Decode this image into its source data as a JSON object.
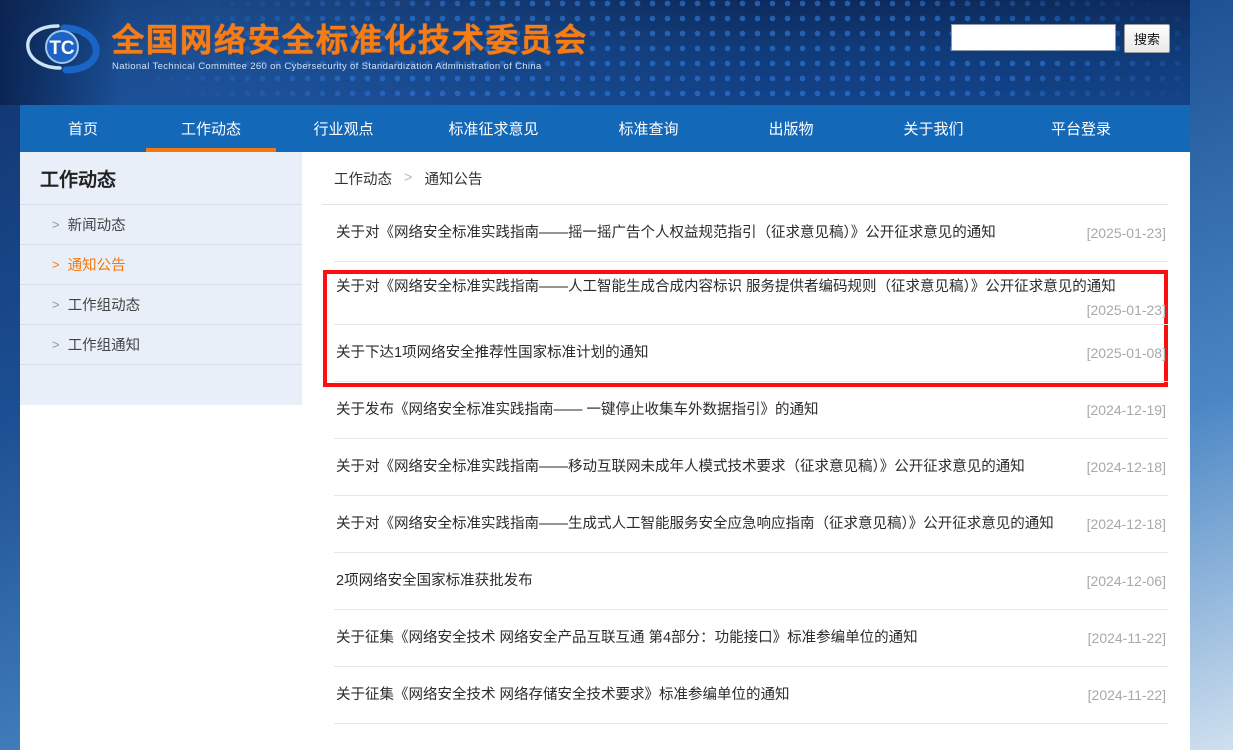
{
  "site": {
    "logo_icon": "tc-emblem-icon",
    "title_cn": "全国网络安全标准化技术委员会",
    "title_en": "National Technical Committee 260 on Cybersecurity of Standardization Administration of China"
  },
  "search": {
    "value": "",
    "placeholder": "",
    "button_label": "搜索"
  },
  "nav": {
    "items": [
      {
        "label": "首页",
        "active": false
      },
      {
        "label": "工作动态",
        "active": true
      },
      {
        "label": "行业观点",
        "active": false
      },
      {
        "label": "标准征求意见",
        "active": false
      },
      {
        "label": "标准查询",
        "active": false
      },
      {
        "label": "出版物",
        "active": false
      },
      {
        "label": "关于我们",
        "active": false
      },
      {
        "label": "平台登录",
        "active": false
      }
    ]
  },
  "sidebar": {
    "title": "工作动态",
    "chevron": ">",
    "items": [
      {
        "label": "新闻动态",
        "active": false
      },
      {
        "label": "通知公告",
        "active": true
      },
      {
        "label": "工作组动态",
        "active": false
      },
      {
        "label": "工作组通知",
        "active": false
      }
    ]
  },
  "breadcrumb": {
    "parent": "工作动态",
    "separator": ">",
    "current": "通知公告"
  },
  "news": {
    "items": [
      {
        "title": "关于对《网络安全标准实践指南——摇一摇广告个人权益规范指引（征求意见稿）》公开征求意见的通知",
        "date": "[2025-01-23]",
        "highlighted": true,
        "wrapped": false
      },
      {
        "title": "关于对《网络安全标准实践指南——人工智能生成合成内容标识 服务提供者编码规则（征求意见稿）》公开征求意见的通知",
        "date": "[2025-01-23]",
        "highlighted": true,
        "wrapped": true
      },
      {
        "title": "关于下达1项网络安全推荐性国家标准计划的通知",
        "date": "[2025-01-08]",
        "highlighted": false,
        "wrapped": false
      },
      {
        "title": "关于发布《网络安全标准实践指南—— 一键停止收集车外数据指引》的通知",
        "date": "[2024-12-19]",
        "highlighted": false,
        "wrapped": false
      },
      {
        "title": "关于对《网络安全标准实践指南——移动互联网未成年人模式技术要求（征求意见稿）》公开征求意见的通知",
        "date": "[2024-12-18]",
        "highlighted": false,
        "wrapped": false
      },
      {
        "title": "关于对《网络安全标准实践指南——生成式人工智能服务安全应急响应指南（征求意见稿）》公开征求意见的通知",
        "date": "[2024-12-18]",
        "highlighted": false,
        "wrapped": false
      },
      {
        "title": "2项网络安全国家标准获批发布",
        "date": "[2024-12-06]",
        "highlighted": false,
        "wrapped": false
      },
      {
        "title": "关于征集《网络安全技术 网络安全产品互联互通 第4部分：功能接口》标准参编单位的通知",
        "date": "[2024-11-22]",
        "highlighted": false,
        "wrapped": false
      },
      {
        "title": "关于征集《网络安全技术 网络存储安全技术要求》标准参编单位的通知",
        "date": "[2024-11-22]",
        "highlighted": false,
        "wrapped": false
      }
    ]
  },
  "colors": {
    "brand_orange": "#f4780f",
    "nav_blue": "#1468b8",
    "header_dark_blue": "#103a77",
    "highlight_red": "#fb0f0f",
    "sidebar_bg": "#e9eff9"
  }
}
